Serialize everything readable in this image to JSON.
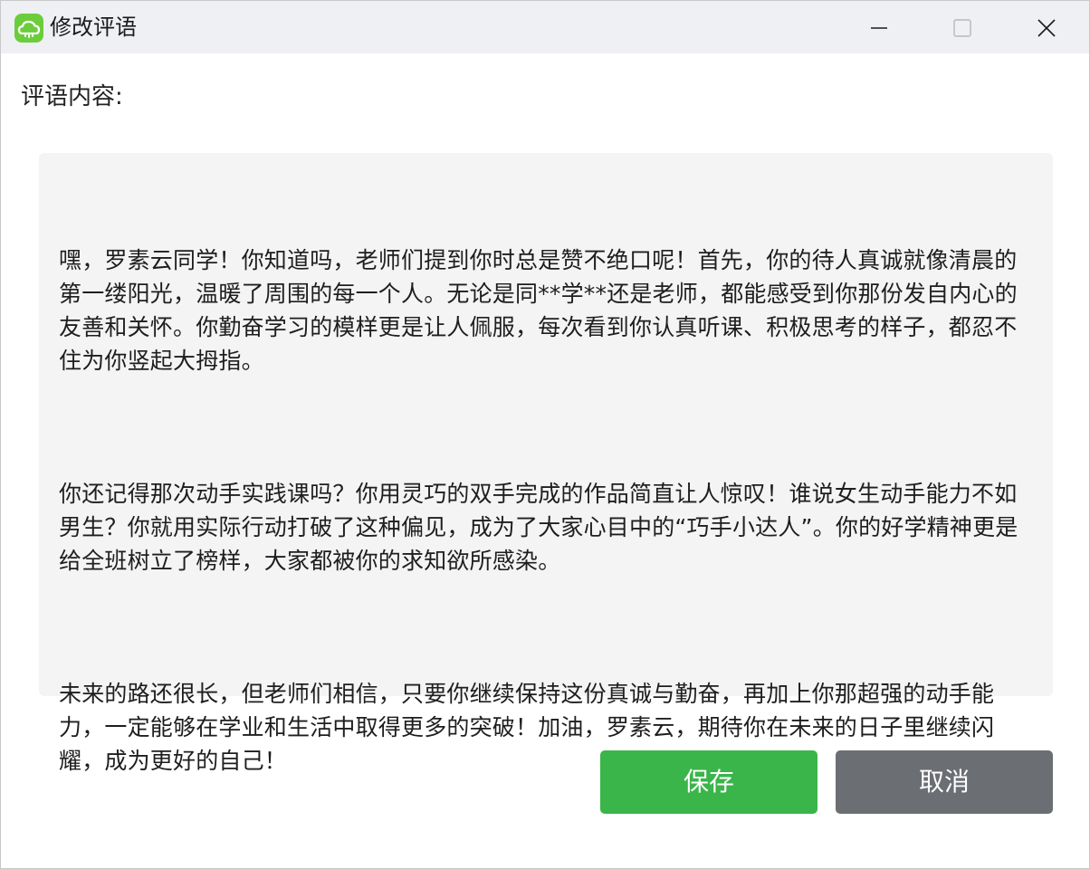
{
  "window": {
    "title": "修改评语",
    "icon": "cloud-app-icon",
    "controls": {
      "minimize": "minimize-icon",
      "maximize": "maximize-icon",
      "close": "close-icon"
    }
  },
  "form": {
    "label": "评语内容:",
    "paragraphs": [
      "嘿，罗素云同学！你知道吗，老师们提到你时总是赞不绝口呢！首先，你的待人真诚就像清晨的第一缕阳光，温暖了周围的每一个人。无论是同**学**还是老师，都能感受到你那份发自内心的友善和关怀。你勤奋学习的模样更是让人佩服，每次看到你认真听课、积极思考的样子，都忍不住为你竖起大拇指。",
      "你还记得那次动手实践课吗？你用灵巧的双手完成的作品简直让人惊叹！谁说女生动手能力不如男生？你就用实际行动打破了这种偏见，成为了大家心目中的“巧手小达人”。你的好学精神更是给全班树立了榜样，大家都被你的求知欲所感染。",
      "未来的路还很长，但老师们相信，只要你继续保持这份真诚与勤奋，再加上你那超强的动手能力，一定能够在学业和生活中取得更多的突破！加油，罗素云，期待你在未来的日子里继续闪耀，成为更好的自己！"
    ]
  },
  "buttons": {
    "save": "保存",
    "cancel": "取消"
  },
  "colors": {
    "titlebar": "#eef0f4",
    "save": "#3ab54a",
    "cancel": "#6b6e73",
    "content_bg": "#f4f4f5",
    "app_icon": "#6ccd3c"
  }
}
